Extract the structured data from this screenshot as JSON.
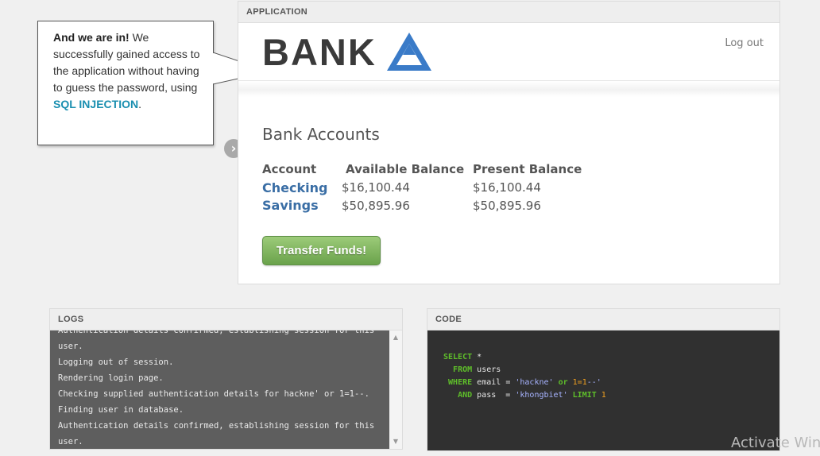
{
  "callout": {
    "bold_text": "And we are in!",
    "text_before": " We successfully gained access to the application without having to guess the password, using ",
    "highlight": "SQL INJECTION",
    "text_after": ".",
    "next_icon": "chevron-right-icon"
  },
  "app": {
    "header": "APPLICATION",
    "logo_text": "BANK",
    "logout": "Log out",
    "accounts_title": "Bank Accounts",
    "columns": [
      "Account",
      "Available Balance",
      "Present Balance"
    ],
    "accounts": [
      {
        "name": "Checking",
        "available": "$16,100.44",
        "present": "$16,100.44"
      },
      {
        "name": "Savings",
        "available": "$50,895.96",
        "present": "$50,895.96"
      }
    ],
    "transfer_button": "Transfer Funds!",
    "logo_color": "#3a7bc8",
    "button_color": "#7bb35a"
  },
  "logs": {
    "header": "LOGS",
    "lines": [
      "Authentication details confirmed, establishing session for this",
      "user.",
      "Logging out of session.",
      "Rendering login page.",
      "Checking supplied authentication details for hackne' or 1=1--.",
      "Finding user in database.",
      "Authentication details confirmed, establishing session for this",
      "user."
    ]
  },
  "code": {
    "header": "CODE",
    "select_kw": "SELECT",
    "select_val": "*",
    "from_kw": "FROM",
    "from_val": "users",
    "where_kw": "WHERE",
    "where_col": "email",
    "eq": "=",
    "where_str_a": "'hackne'",
    "or_kw": "or",
    "where_num": "1=1",
    "where_str_b": "--'",
    "and_kw": "AND",
    "and_col": "pass",
    "and_str": "'khongbiet'",
    "limit_kw": "LIMIT",
    "limit_num": "1"
  },
  "watermark": "Activate Win"
}
